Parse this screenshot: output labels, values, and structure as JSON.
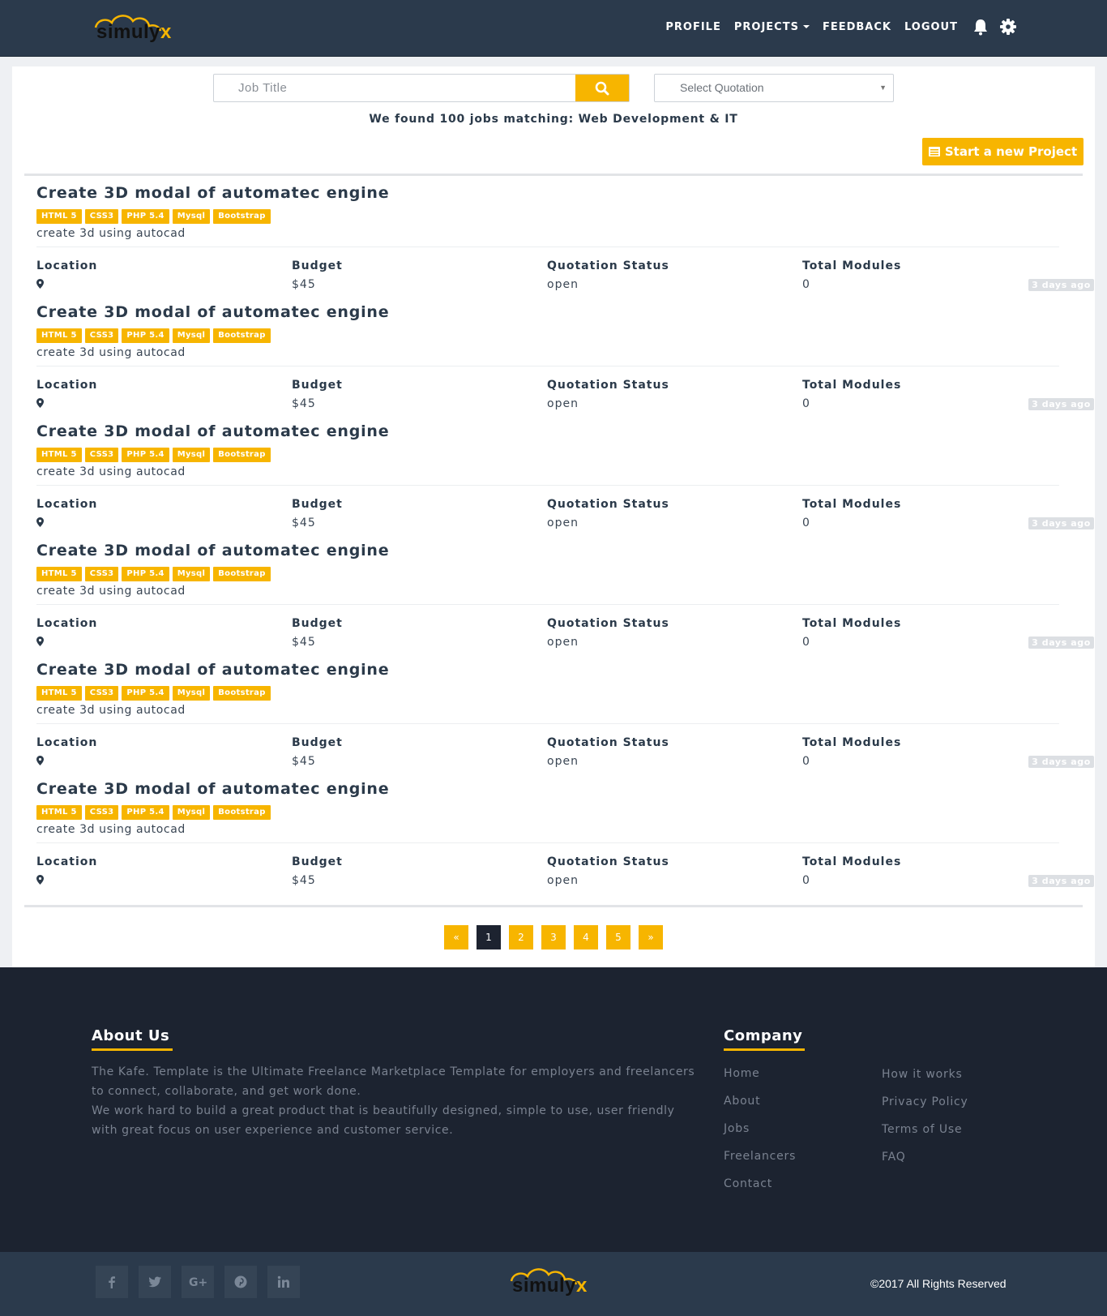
{
  "brand": {
    "name": "simuly",
    "suffix": "x"
  },
  "nav": {
    "profile": "PROFILE",
    "projects": "PROJECTS",
    "feedback": "FEEDBACK",
    "logout": "LOGOUT"
  },
  "search": {
    "placeholder": "Job Title",
    "select_placeholder": "Select Quotation"
  },
  "results_text": "We found 100 jobs matching: Web Development & IT",
  "new_project_label": "Start a new Project",
  "meta_labels": {
    "location": "Location",
    "budget": "Budget",
    "status": "Quotation Status",
    "modules": "Total Modules"
  },
  "jobs": [
    {
      "title": "Create 3D modal of automatec engine",
      "tags": [
        "HTML 5",
        "CSS3",
        "PHP 5.4",
        "Mysql",
        "Bootstrap"
      ],
      "description": "create 3d using autocad",
      "budget": "$45",
      "status": "open",
      "modules": "0",
      "posted": "3 days ago"
    },
    {
      "title": "Create 3D modal of automatec engine",
      "tags": [
        "HTML 5",
        "CSS3",
        "PHP 5.4",
        "Mysql",
        "Bootstrap"
      ],
      "description": "create 3d using autocad",
      "budget": "$45",
      "status": "open",
      "modules": "0",
      "posted": "3 days ago"
    },
    {
      "title": "Create 3D modal of automatec engine",
      "tags": [
        "HTML 5",
        "CSS3",
        "PHP 5.4",
        "Mysql",
        "Bootstrap"
      ],
      "description": "create 3d using autocad",
      "budget": "$45",
      "status": "open",
      "modules": "0",
      "posted": "3 days ago"
    },
    {
      "title": "Create 3D modal of automatec engine",
      "tags": [
        "HTML 5",
        "CSS3",
        "PHP 5.4",
        "Mysql",
        "Bootstrap"
      ],
      "description": "create 3d using autocad",
      "budget": "$45",
      "status": "open",
      "modules": "0",
      "posted": "3 days ago"
    },
    {
      "title": "Create 3D modal of automatec engine",
      "tags": [
        "HTML 5",
        "CSS3",
        "PHP 5.4",
        "Mysql",
        "Bootstrap"
      ],
      "description": "create 3d using autocad",
      "budget": "$45",
      "status": "open",
      "modules": "0",
      "posted": "3 days ago"
    },
    {
      "title": "Create 3D modal of automatec engine",
      "tags": [
        "HTML 5",
        "CSS3",
        "PHP 5.4",
        "Mysql",
        "Bootstrap"
      ],
      "description": "create 3d using autocad",
      "budget": "$45",
      "status": "open",
      "modules": "0",
      "posted": "3 days ago"
    }
  ],
  "pagination": {
    "prev": "«",
    "pages": [
      "1",
      "2",
      "3",
      "4",
      "5"
    ],
    "next": "»",
    "current": "1"
  },
  "footer": {
    "about_title": "About Us",
    "about_p1": "The Kafe. Template is the Ultimate Freelance Marketplace Template for employers and freelancers to connect, collaborate, and get work done.",
    "about_p2": "We work hard to build a great product that is beautifully designed, simple to use, user friendly with great focus on user experience and customer service.",
    "company_title": "Company",
    "links_col1": [
      "Home",
      "About",
      "Jobs",
      "Freelancers",
      "Contact"
    ],
    "links_col2": [
      "How it works",
      "Privacy Policy",
      "Terms of Use",
      "FAQ"
    ],
    "copyright": "©2017 All Rights Reserved",
    "social_icons": [
      "facebook-icon",
      "twitter-icon",
      "google-plus-icon",
      "pinterest-icon",
      "linkedin-icon"
    ]
  },
  "colors": {
    "accent": "#f7b500",
    "navbar": "#2b3a4c",
    "footer": "#1c2330",
    "text": "#2b3a4a"
  }
}
